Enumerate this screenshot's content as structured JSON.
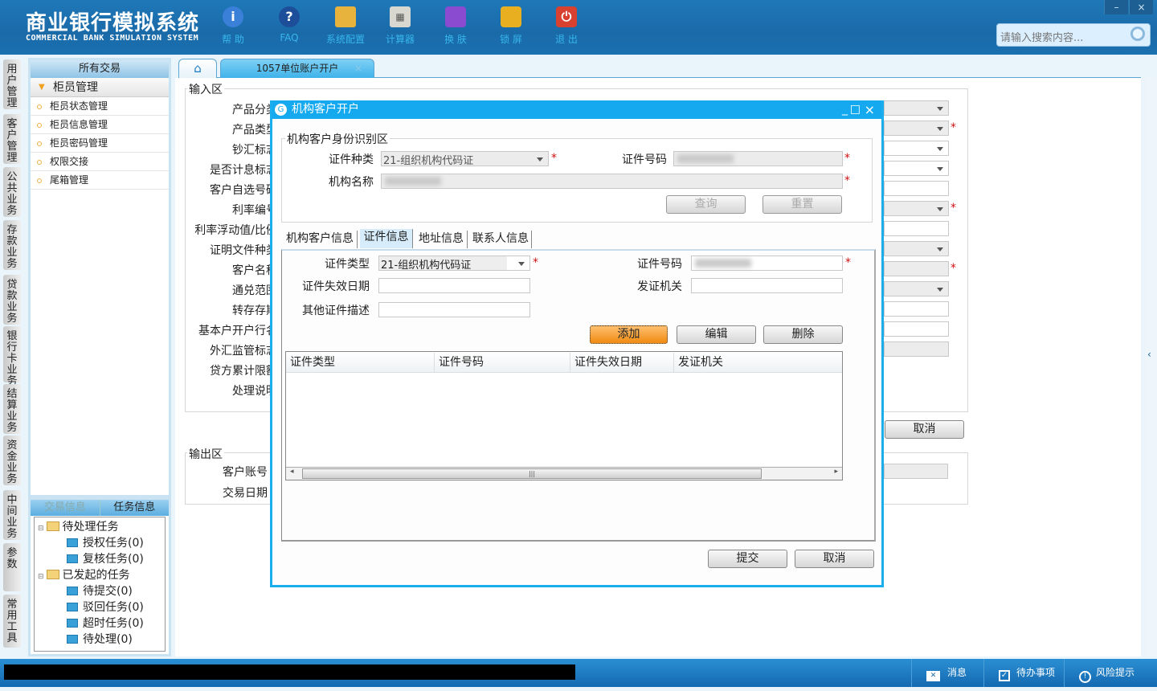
{
  "app": {
    "title": "商业银行模拟系统",
    "subtitle": "COMMERCIAL BANK SIMULATION SYSTEM"
  },
  "toolbar": [
    {
      "label": "帮 助",
      "icon": "info-icon"
    },
    {
      "label": "FAQ",
      "icon": "question-icon"
    },
    {
      "label": "系统配置",
      "icon": "toolbox-icon"
    },
    {
      "label": "计算器",
      "icon": "calculator-icon"
    },
    {
      "label": "换 肤",
      "icon": "shirt-icon"
    },
    {
      "label": "锁 屏",
      "icon": "lock-icon"
    },
    {
      "label": "退 出",
      "icon": "power-icon"
    }
  ],
  "window": {
    "minimize": "–",
    "close": "×"
  },
  "search": {
    "placeholder": "请输入搜索内容..."
  },
  "vtabs": [
    "用户管理",
    "客户管理",
    "公共业务",
    "存款业务",
    "贷款业务",
    "银行卡业务",
    "结算业务",
    "资金业务",
    "中间业务",
    "参数",
    "常用工具"
  ],
  "sidebar": {
    "header": "所有交易",
    "group": "柜员管理",
    "items": [
      "柜员状态管理",
      "柜员信息管理",
      "柜员密码管理",
      "权限交接",
      "尾箱管理"
    ]
  },
  "task_panel": {
    "tabs": [
      "交易信息",
      "任务信息"
    ],
    "tree": [
      {
        "label": "待处理任务",
        "children": [
          "授权任务(0)",
          "复核任务(0)"
        ]
      },
      {
        "label": "已发起的任务",
        "children": [
          "待提交(0)",
          "驳回任务(0)",
          "超时任务(0)",
          "待处理(0)"
        ]
      }
    ]
  },
  "tabs": {
    "home": "home-icon",
    "active": "1057单位账户开户",
    "close": "×"
  },
  "form": {
    "input_legend": "输入区",
    "labels": [
      "产品分类",
      "产品类型",
      "钞汇标志",
      "是否计息标志",
      "客户自选号码",
      "利率编号",
      "利率浮动值/比例",
      "证明文件种类",
      "客户名称",
      "通兑范围",
      "转存存期",
      "基本户开户行名",
      "外汇监管标志",
      "贷方累计限额",
      "处理说明"
    ],
    "cancel": "取消",
    "output_legend": "输出区",
    "output_labels": [
      "客户账号",
      "交易日期"
    ]
  },
  "dialog": {
    "title": "机构客户开户",
    "controls": [
      "_",
      "□",
      "×"
    ],
    "id_section": {
      "legend": "机构客户身份识别区",
      "id_kind_label": "证件种类",
      "id_kind_value": "21-组织机构代码证",
      "id_no_label": "证件号码",
      "name_label": "机构名称",
      "query": "查询",
      "reset": "重置"
    },
    "tabs": [
      "机构客户信息",
      "证件信息",
      "地址信息",
      "联系人信息"
    ],
    "cert": {
      "type_label": "证件类型",
      "type_value": "21-组织机构代码证",
      "no_label": "证件号码",
      "expire_label": "证件失效日期",
      "issuer_label": "发证机关",
      "other_label": "其他证件描述",
      "add": "添加",
      "edit": "编辑",
      "delete": "删除"
    },
    "table": {
      "columns": [
        "证件类型",
        "证件号码",
        "证件失效日期",
        "发证机关"
      ],
      "rows": []
    },
    "submit": "提交",
    "cancel": "取消"
  },
  "statusbar": {
    "message": "消息",
    "todo": "待办事项",
    "risk": "风险提示"
  },
  "colors": {
    "header": "#1a6aa8",
    "dialog": "#15aaf0",
    "accent_button": "#f08a10",
    "required": "#d01010"
  }
}
